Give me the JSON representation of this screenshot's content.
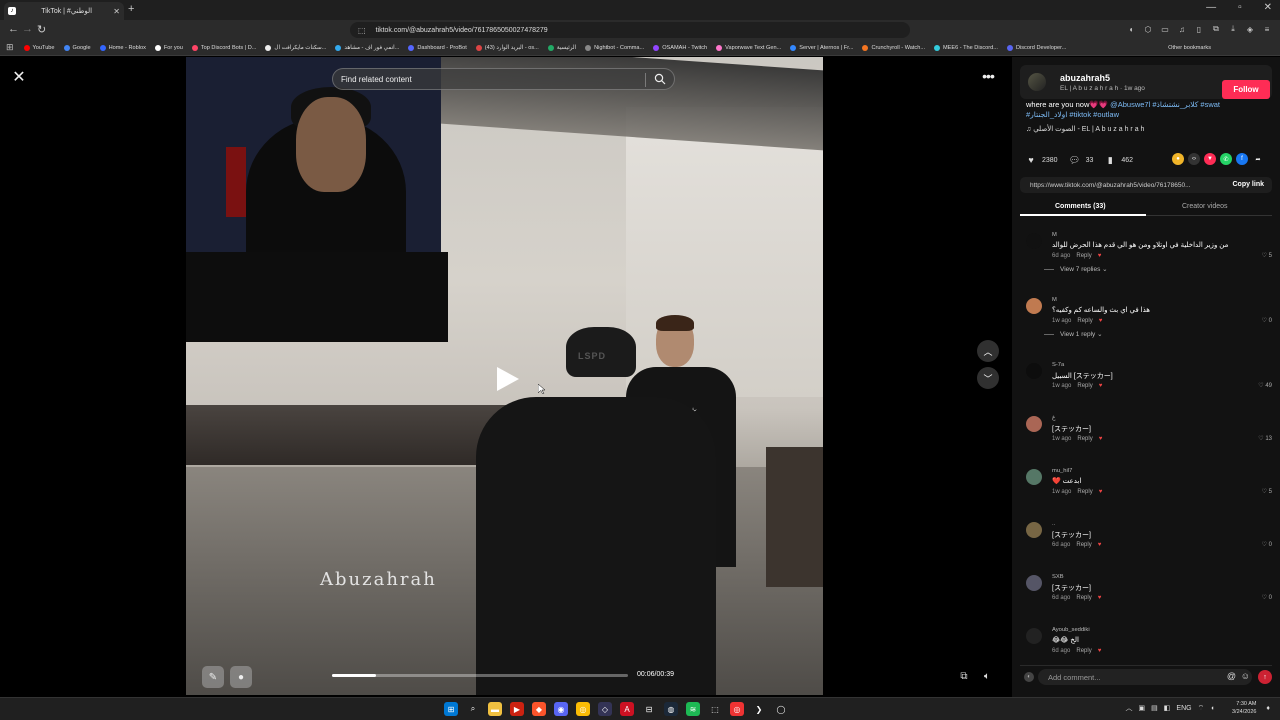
{
  "browser": {
    "tab_title": "TikTok | #الوطني",
    "url": "tiktok.com/@abuzahrah5/video/7617865050027478279",
    "bookmarks": [
      {
        "label": "YouTube",
        "color": "#ff0000"
      },
      {
        "label": "Google",
        "color": "#4285f4"
      },
      {
        "label": "Home - Roblox",
        "color": "#3366ff"
      },
      {
        "label": "For you",
        "color": "#ffffff"
      },
      {
        "label": "Top Discord Bots | D...",
        "color": "#ff4466"
      },
      {
        "label": "سكنات مايكرافت ال...",
        "color": "#eeeeee"
      },
      {
        "label": "انمي فور اف - مشاهد...",
        "color": "#33aaee"
      },
      {
        "label": "Dashboard - ProBot",
        "color": "#5566ff"
      },
      {
        "label": "(43) البريد الوارد - os...",
        "color": "#dd4444"
      },
      {
        "label": "الرئيسية",
        "color": "#22aa66"
      },
      {
        "label": "Nightbot - Comma...",
        "color": "#888888"
      },
      {
        "label": "OSAMAH - Twitch",
        "color": "#9146ff"
      },
      {
        "label": "Vaporwave Text Gen...",
        "color": "#ff77cc"
      },
      {
        "label": "Server | Aternos | Fr...",
        "color": "#3388ff"
      },
      {
        "label": "Crunchyroll - Watch...",
        "color": "#f47521"
      },
      {
        "label": "MEE6 - The Discord...",
        "color": "#33ccdd"
      },
      {
        "label": "Discord Developer...",
        "color": "#5865f2"
      }
    ],
    "other_bookmarks": "Other bookmarks"
  },
  "player": {
    "search_placeholder": "Find related content",
    "watermark": "Abuzahrah",
    "cap_text": "LSPD",
    "time": "00:06/00:39",
    "progress": 0.15
  },
  "author": {
    "name": "abuzahrah5",
    "subtitle": "EL | A b u z a h r a h · 1w ago",
    "follow_label": "Follow"
  },
  "caption": {
    "text": "where are you now💗💗",
    "tags_line1": "@Abuswe7l #كلابر_نشتشاذ #swat",
    "tags_line2": "#اولاد_الجنتار #tiktok #outlaw",
    "sound": "♫  الصوت الأصلي - EL | A b u z a h r a h"
  },
  "stats": {
    "likes": "2380",
    "comments": "33",
    "saves": "462"
  },
  "share": {
    "link": "https://www.tiktok.com/@abuzahrah5/video/76178650...",
    "copy_label": "Copy link"
  },
  "tabs": {
    "comments": "Comments (33)",
    "creator": "Creator videos"
  },
  "comments": [
    {
      "name": "M",
      "text": "من وزير الداخلية في اوتلاو ومن هو الي قدم هذا الحرض للوالد",
      "time": "6d ago",
      "likes": "5",
      "replies": "View 7 replies",
      "avatar": "#111111"
    },
    {
      "name": "M",
      "text": "هذا في اي بث والساعه كم وكفيه؟",
      "time": "1w ago",
      "likes": "0",
      "replies": "View 1 reply",
      "avatar": "#c07a50"
    },
    {
      "name": "S-7a",
      "text": "السبيل [ステッカー]",
      "time": "1w ago",
      "likes": "49",
      "replies": "",
      "avatar": "#0d0d0d"
    },
    {
      "name": "غ",
      "text": "[ステッカー]",
      "time": "1w ago",
      "likes": "13",
      "replies": "",
      "avatar": "#aa6655"
    },
    {
      "name": "mu_hil7",
      "text": "❤️ ابدعت",
      "time": "1w ago",
      "likes": "5",
      "replies": "",
      "avatar": "#557766"
    },
    {
      "name": "..",
      "text": "[ステッカー]",
      "time": "6d ago",
      "likes": "0",
      "replies": "",
      "avatar": "#776644"
    },
    {
      "name": "SXB",
      "text": "[ステッカー]",
      "time": "6d ago",
      "likes": "0",
      "replies": "",
      "avatar": "#555566"
    },
    {
      "name": "Ayoub_seddiki",
      "text": "😂😂 الخ",
      "time": "6d ago",
      "likes": "",
      "replies": "",
      "avatar": "#222222"
    }
  ],
  "reply_label": "Reply",
  "comment_input": {
    "placeholder": "Add comment..."
  },
  "taskbar": {
    "time": "7:30 AM",
    "date": "3/24/2026",
    "lang": "ENG"
  }
}
